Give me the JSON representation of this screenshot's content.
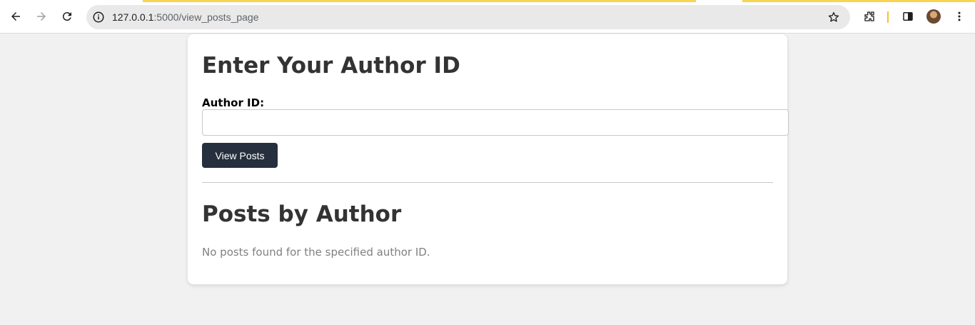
{
  "browser": {
    "url_host": "127.0.0.1",
    "url_rest": ":5000/view_posts_page",
    "icons": {
      "back": "back-arrow-icon",
      "forward": "forward-arrow-icon",
      "reload": "reload-icon",
      "info": "info-icon",
      "star": "bookmark-star-icon",
      "extensions": "puzzle-icon",
      "side_panel": "side-panel-icon",
      "avatar": "profile-avatar",
      "menu": "kebab-menu-icon"
    }
  },
  "page": {
    "heading": "Enter Your Author ID",
    "author_id_label": "Author ID:",
    "author_id_value": "",
    "submit_label": "View Posts",
    "posts_heading": "Posts by Author",
    "empty_message": "No posts found for the specified author ID."
  },
  "colors": {
    "button_bg": "#252f3e",
    "page_bg": "#f1f1f1",
    "heading": "#333333",
    "muted_text": "#808080",
    "loading_bar": "#f8d452"
  }
}
